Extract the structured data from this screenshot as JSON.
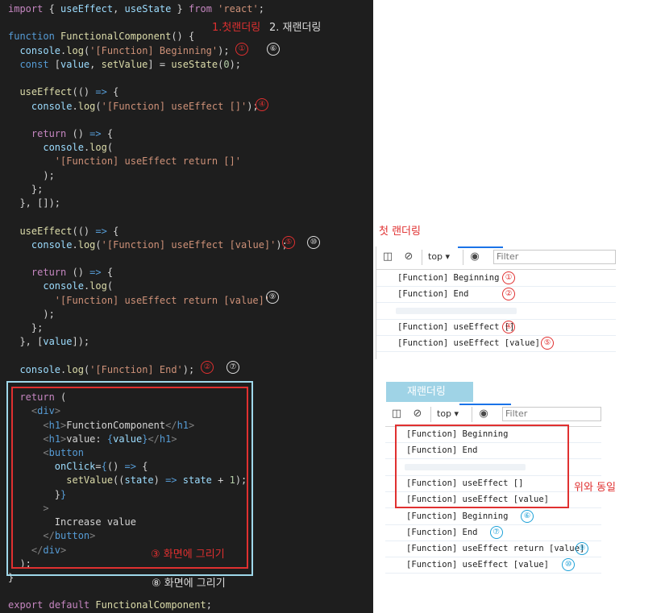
{
  "code_lines": [
    {
      "segs": [
        {
          "c": "kc",
          "t": "import"
        },
        {
          "c": "",
          "t": " { "
        },
        {
          "c": "vr",
          "t": "useEffect"
        },
        {
          "c": "",
          "t": ", "
        },
        {
          "c": "vr",
          "t": "useState"
        },
        {
          "c": "",
          "t": " } "
        },
        {
          "c": "kc",
          "t": "from"
        },
        {
          "c": "",
          "t": " "
        },
        {
          "c": "st",
          "t": "'react'"
        },
        {
          "c": "",
          "t": ";"
        }
      ]
    },
    {
      "segs": []
    },
    {
      "segs": [
        {
          "c": "kw",
          "t": "function"
        },
        {
          "c": "",
          "t": " "
        },
        {
          "c": "fn",
          "t": "FunctionalComponent"
        },
        {
          "c": "",
          "t": "() {"
        }
      ]
    },
    {
      "segs": [
        {
          "c": "",
          "t": "  "
        },
        {
          "c": "vr",
          "t": "console"
        },
        {
          "c": "",
          "t": "."
        },
        {
          "c": "fn",
          "t": "log"
        },
        {
          "c": "",
          "t": "("
        },
        {
          "c": "st",
          "t": "'[Function] Beginning'"
        },
        {
          "c": "",
          "t": ");"
        }
      ]
    },
    {
      "segs": [
        {
          "c": "",
          "t": "  "
        },
        {
          "c": "kw",
          "t": "const"
        },
        {
          "c": "",
          "t": " ["
        },
        {
          "c": "vr",
          "t": "value"
        },
        {
          "c": "",
          "t": ", "
        },
        {
          "c": "fn",
          "t": "setValue"
        },
        {
          "c": "",
          "t": "] = "
        },
        {
          "c": "fn",
          "t": "useState"
        },
        {
          "c": "",
          "t": "("
        },
        {
          "c": "nm",
          "t": "0"
        },
        {
          "c": "",
          "t": ");"
        }
      ]
    },
    {
      "segs": []
    },
    {
      "segs": [
        {
          "c": "",
          "t": "  "
        },
        {
          "c": "fn",
          "t": "useEffect"
        },
        {
          "c": "",
          "t": "(() "
        },
        {
          "c": "kw",
          "t": "=>"
        },
        {
          "c": "",
          "t": " {"
        }
      ]
    },
    {
      "segs": [
        {
          "c": "",
          "t": "    "
        },
        {
          "c": "vr",
          "t": "console"
        },
        {
          "c": "",
          "t": "."
        },
        {
          "c": "fn",
          "t": "log"
        },
        {
          "c": "",
          "t": "("
        },
        {
          "c": "st",
          "t": "'[Function] useEffect []'"
        },
        {
          "c": "",
          "t": ");"
        }
      ]
    },
    {
      "segs": []
    },
    {
      "segs": [
        {
          "c": "",
          "t": "    "
        },
        {
          "c": "kc",
          "t": "return"
        },
        {
          "c": "",
          "t": " () "
        },
        {
          "c": "kw",
          "t": "=>"
        },
        {
          "c": "",
          "t": " {"
        }
      ]
    },
    {
      "segs": [
        {
          "c": "",
          "t": "      "
        },
        {
          "c": "vr",
          "t": "console"
        },
        {
          "c": "",
          "t": "."
        },
        {
          "c": "fn",
          "t": "log"
        },
        {
          "c": "",
          "t": "("
        }
      ]
    },
    {
      "segs": [
        {
          "c": "",
          "t": "        "
        },
        {
          "c": "st",
          "t": "'[Function] useEffect return []'"
        }
      ]
    },
    {
      "segs": [
        {
          "c": "",
          "t": "      );"
        }
      ]
    },
    {
      "segs": [
        {
          "c": "",
          "t": "    };"
        }
      ]
    },
    {
      "segs": [
        {
          "c": "",
          "t": "  }, []);"
        }
      ]
    },
    {
      "segs": []
    },
    {
      "segs": [
        {
          "c": "",
          "t": "  "
        },
        {
          "c": "fn",
          "t": "useEffect"
        },
        {
          "c": "",
          "t": "(() "
        },
        {
          "c": "kw",
          "t": "=>"
        },
        {
          "c": "",
          "t": " {"
        }
      ]
    },
    {
      "segs": [
        {
          "c": "",
          "t": "    "
        },
        {
          "c": "vr",
          "t": "console"
        },
        {
          "c": "",
          "t": "."
        },
        {
          "c": "fn",
          "t": "log"
        },
        {
          "c": "",
          "t": "("
        },
        {
          "c": "st",
          "t": "'[Function] useEffect [value]'"
        },
        {
          "c": "",
          "t": ");"
        }
      ]
    },
    {
      "segs": []
    },
    {
      "segs": [
        {
          "c": "",
          "t": "    "
        },
        {
          "c": "kc",
          "t": "return"
        },
        {
          "c": "",
          "t": " () "
        },
        {
          "c": "kw",
          "t": "=>"
        },
        {
          "c": "",
          "t": " {"
        }
      ]
    },
    {
      "segs": [
        {
          "c": "",
          "t": "      "
        },
        {
          "c": "vr",
          "t": "console"
        },
        {
          "c": "",
          "t": "."
        },
        {
          "c": "fn",
          "t": "log"
        },
        {
          "c": "",
          "t": "("
        }
      ]
    },
    {
      "segs": [
        {
          "c": "",
          "t": "        "
        },
        {
          "c": "st",
          "t": "'[Function] useEffect return [value]'"
        }
      ]
    },
    {
      "segs": [
        {
          "c": "",
          "t": "      );"
        }
      ]
    },
    {
      "segs": [
        {
          "c": "",
          "t": "    };"
        }
      ]
    },
    {
      "segs": [
        {
          "c": "",
          "t": "  }, ["
        },
        {
          "c": "vr",
          "t": "value"
        },
        {
          "c": "",
          "t": "]);"
        }
      ]
    },
    {
      "segs": []
    },
    {
      "segs": [
        {
          "c": "",
          "t": "  "
        },
        {
          "c": "vr",
          "t": "console"
        },
        {
          "c": "",
          "t": "."
        },
        {
          "c": "fn",
          "t": "log"
        },
        {
          "c": "",
          "t": "("
        },
        {
          "c": "st",
          "t": "'[Function] End'"
        },
        {
          "c": "",
          "t": ");"
        }
      ]
    },
    {
      "segs": []
    },
    {
      "segs": [
        {
          "c": "",
          "t": "  "
        },
        {
          "c": "kc",
          "t": "return"
        },
        {
          "c": "",
          "t": " ("
        }
      ]
    },
    {
      "segs": [
        {
          "c": "",
          "t": "    "
        },
        {
          "c": "gr",
          "t": "<"
        },
        {
          "c": "tg",
          "t": "div"
        },
        {
          "c": "gr",
          "t": ">"
        }
      ]
    },
    {
      "segs": [
        {
          "c": "",
          "t": "      "
        },
        {
          "c": "gr",
          "t": "<"
        },
        {
          "c": "tg",
          "t": "h1"
        },
        {
          "c": "gr",
          "t": ">"
        },
        {
          "c": "",
          "t": "FunctionComponent"
        },
        {
          "c": "gr",
          "t": "</"
        },
        {
          "c": "tg",
          "t": "h1"
        },
        {
          "c": "gr",
          "t": ">"
        }
      ]
    },
    {
      "segs": [
        {
          "c": "",
          "t": "      "
        },
        {
          "c": "gr",
          "t": "<"
        },
        {
          "c": "tg",
          "t": "h1"
        },
        {
          "c": "gr",
          "t": ">"
        },
        {
          "c": "",
          "t": "value: "
        },
        {
          "c": "kw",
          "t": "{"
        },
        {
          "c": "vr",
          "t": "value"
        },
        {
          "c": "kw",
          "t": "}"
        },
        {
          "c": "gr",
          "t": "</"
        },
        {
          "c": "tg",
          "t": "h1"
        },
        {
          "c": "gr",
          "t": ">"
        }
      ]
    },
    {
      "segs": [
        {
          "c": "",
          "t": "      "
        },
        {
          "c": "gr",
          "t": "<"
        },
        {
          "c": "tg",
          "t": "button"
        }
      ]
    },
    {
      "segs": [
        {
          "c": "",
          "t": "        "
        },
        {
          "c": "vr",
          "t": "onClick"
        },
        {
          "c": "",
          "t": "="
        },
        {
          "c": "kw",
          "t": "{"
        },
        {
          "c": "",
          "t": "() "
        },
        {
          "c": "kw",
          "t": "=>"
        },
        {
          "c": "",
          "t": " {"
        }
      ]
    },
    {
      "segs": [
        {
          "c": "",
          "t": "          "
        },
        {
          "c": "fn",
          "t": "setValue"
        },
        {
          "c": "",
          "t": "(("
        },
        {
          "c": "vr",
          "t": "state"
        },
        {
          "c": "",
          "t": ") "
        },
        {
          "c": "kw",
          "t": "=>"
        },
        {
          "c": "",
          "t": " "
        },
        {
          "c": "vr",
          "t": "state"
        },
        {
          "c": "",
          "t": " + "
        },
        {
          "c": "nm",
          "t": "1"
        },
        {
          "c": "",
          "t": ");"
        }
      ]
    },
    {
      "segs": [
        {
          "c": "",
          "t": "        }"
        },
        {
          "c": "kw",
          "t": "}"
        }
      ]
    },
    {
      "segs": [
        {
          "c": "",
          "t": "      "
        },
        {
          "c": "gr",
          "t": ">"
        }
      ]
    },
    {
      "segs": [
        {
          "c": "",
          "t": "        Increase value"
        }
      ]
    },
    {
      "segs": [
        {
          "c": "",
          "t": "      "
        },
        {
          "c": "gr",
          "t": "</"
        },
        {
          "c": "tg",
          "t": "button"
        },
        {
          "c": "gr",
          "t": ">"
        }
      ]
    },
    {
      "segs": [
        {
          "c": "",
          "t": "    "
        },
        {
          "c": "gr",
          "t": "</"
        },
        {
          "c": "tg",
          "t": "div"
        },
        {
          "c": "gr",
          "t": ">"
        }
      ]
    },
    {
      "segs": [
        {
          "c": "",
          "t": "  );"
        }
      ]
    },
    {
      "segs": [
        {
          "c": "",
          "t": "}"
        }
      ]
    },
    {
      "segs": []
    },
    {
      "segs": [
        {
          "c": "kc",
          "t": "export"
        },
        {
          "c": "",
          "t": " "
        },
        {
          "c": "kc",
          "t": "default"
        },
        {
          "c": "",
          "t": " "
        },
        {
          "c": "fn",
          "t": "FunctionalComponent"
        },
        {
          "c": "",
          "t": ";"
        }
      ]
    }
  ],
  "code_annotations": {
    "first_render": "1.첫랜더링",
    "rerender": "2. 재랜더링",
    "draw_screen_red": "③ 화면에 그리기",
    "draw_screen_blue": "⑧ 화면에 그리기"
  },
  "markers": {
    "m1": "①",
    "m2": "②",
    "m4": "④",
    "m5": "⑤",
    "m6": "⑥",
    "m7": "⑦",
    "m9": "⑨",
    "m10": "⑩"
  },
  "first_render_panel": {
    "heading": "첫 랜더링",
    "context": "top",
    "filter_placeholder": "Filter",
    "rows": [
      "[Function] Beginning",
      "[Function] End",
      "",
      "[Function] useEffect []",
      "[Function] useEffect [value]"
    ],
    "row_markers": [
      "①",
      "②",
      "",
      "④",
      "⑤"
    ]
  },
  "rerender_panel": {
    "heading": "재랜더링",
    "context": "top",
    "filter_placeholder": "Filter",
    "rows": [
      "[Function] Beginning",
      "[Function] End",
      "",
      "[Function] useEffect []",
      "[Function] useEffect [value]",
      "[Function] Beginning",
      "[Function] End",
      "[Function] useEffect return [value]",
      "[Function] useEffect [value]"
    ],
    "row_markers": [
      "",
      "",
      "",
      "",
      "",
      "⑥",
      "⑦",
      "⑨",
      "⑩"
    ],
    "same_as_above": "위와 동일"
  },
  "colors": {
    "editor_bg": "#1e1e1e",
    "annotation_red": "#e03030",
    "annotation_blue": "#1da1d8",
    "box_light_blue": "#9fd8ea",
    "heading_tab_bg": "#9fd3e6"
  }
}
